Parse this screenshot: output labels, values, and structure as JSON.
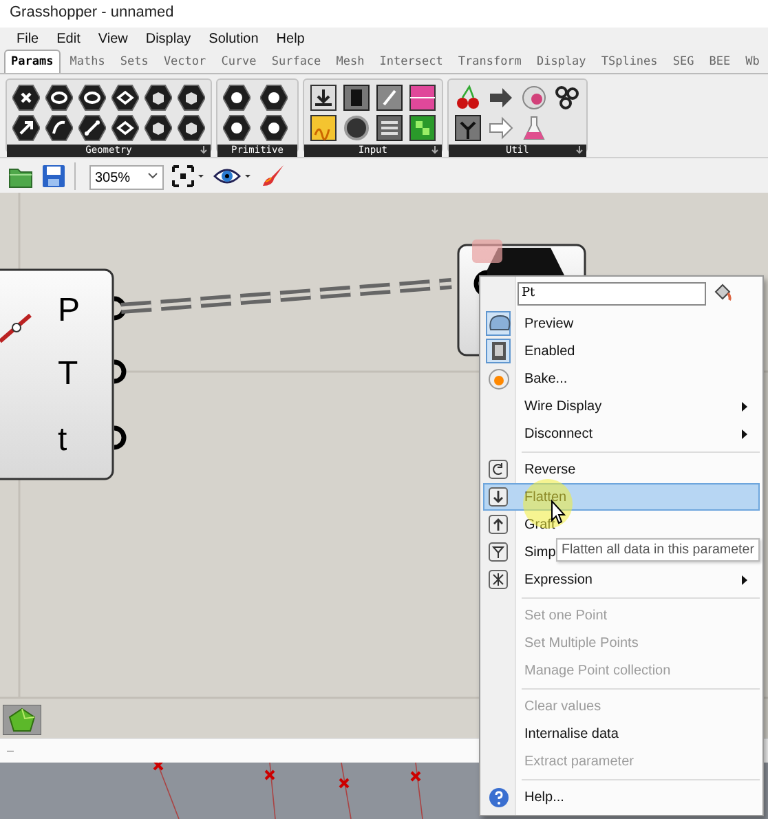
{
  "window": {
    "title": "Grasshopper - unnamed"
  },
  "menu_bar": [
    "File",
    "Edit",
    "View",
    "Display",
    "Solution",
    "Help"
  ],
  "tabs": [
    {
      "label": "Params",
      "selected": true
    },
    {
      "label": "Maths",
      "selected": false
    },
    {
      "label": "Sets",
      "selected": false
    },
    {
      "label": "Vector",
      "selected": false
    },
    {
      "label": "Curve",
      "selected": false
    },
    {
      "label": "Surface",
      "selected": false
    },
    {
      "label": "Mesh",
      "selected": false
    },
    {
      "label": "Intersect",
      "selected": false
    },
    {
      "label": "Transform",
      "selected": false
    },
    {
      "label": "Display",
      "selected": false
    },
    {
      "label": "TSplines",
      "selected": false
    },
    {
      "label": "SEG",
      "selected": false
    },
    {
      "label": "BEE",
      "selected": false
    },
    {
      "label": "Wb",
      "selected": false
    }
  ],
  "ribbon": {
    "groups": [
      {
        "label": "Geometry"
      },
      {
        "label": "Primitive"
      },
      {
        "label": "Input"
      },
      {
        "label": "Util"
      }
    ]
  },
  "toolbar": {
    "zoom": "305%"
  },
  "canvas": {
    "component": {
      "outputs": [
        "P",
        "T",
        "t"
      ]
    }
  },
  "context_menu": {
    "name_field": {
      "value": "Pt"
    },
    "items": [
      {
        "kind": "item",
        "label": "Preview",
        "checked": true,
        "selected": false,
        "disabled": false,
        "submenu": false
      },
      {
        "kind": "item",
        "label": "Enabled",
        "checked": true,
        "selected": false,
        "disabled": false,
        "submenu": false
      },
      {
        "kind": "item",
        "label": "Bake...",
        "checked": false,
        "selected": false,
        "disabled": false,
        "submenu": false
      },
      {
        "kind": "item",
        "label": "Wire Display",
        "checked": false,
        "selected": false,
        "disabled": false,
        "submenu": true
      },
      {
        "kind": "item",
        "label": "Disconnect",
        "checked": false,
        "selected": false,
        "disabled": false,
        "submenu": true
      },
      {
        "kind": "separator"
      },
      {
        "kind": "item",
        "label": "Reverse",
        "checked": false,
        "selected": false,
        "disabled": false,
        "submenu": false
      },
      {
        "kind": "item",
        "label": "Flatten",
        "checked": false,
        "selected": true,
        "disabled": false,
        "submenu": false
      },
      {
        "kind": "item",
        "label": "Graft",
        "checked": false,
        "selected": false,
        "disabled": false,
        "submenu": false
      },
      {
        "kind": "item",
        "label": "Simp",
        "checked": false,
        "selected": false,
        "disabled": false,
        "submenu": false
      },
      {
        "kind": "item",
        "label": "Expression",
        "checked": false,
        "selected": false,
        "disabled": false,
        "submenu": true
      },
      {
        "kind": "separator"
      },
      {
        "kind": "item",
        "label": "Set one Point",
        "checked": false,
        "selected": false,
        "disabled": true,
        "submenu": false
      },
      {
        "kind": "item",
        "label": "Set Multiple Points",
        "checked": false,
        "selected": false,
        "disabled": true,
        "submenu": false
      },
      {
        "kind": "item",
        "label": "Manage Point collection",
        "checked": false,
        "selected": false,
        "disabled": true,
        "submenu": false
      },
      {
        "kind": "separator"
      },
      {
        "kind": "item",
        "label": "Clear values",
        "checked": false,
        "selected": false,
        "disabled": true,
        "submenu": false
      },
      {
        "kind": "item",
        "label": "Internalise data",
        "checked": false,
        "selected": false,
        "disabled": false,
        "submenu": false
      },
      {
        "kind": "item",
        "label": "Extract parameter",
        "checked": false,
        "selected": false,
        "disabled": true,
        "submenu": false
      },
      {
        "kind": "separator"
      },
      {
        "kind": "item",
        "label": "Help...",
        "checked": false,
        "selected": false,
        "disabled": false,
        "submenu": false
      }
    ],
    "tooltip": "Flatten all data in this parameter"
  },
  "status_bar": {
    "text": "–"
  }
}
